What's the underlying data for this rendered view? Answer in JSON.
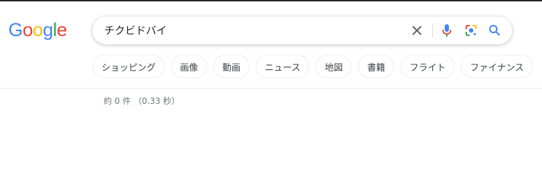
{
  "logo": {
    "text": "Google",
    "letters": [
      {
        "ch": "G",
        "color": "#4285F4"
      },
      {
        "ch": "o",
        "color": "#EA4335"
      },
      {
        "ch": "o",
        "color": "#FBBC05"
      },
      {
        "ch": "g",
        "color": "#4285F4"
      },
      {
        "ch": "l",
        "color": "#34A853"
      },
      {
        "ch": "e",
        "color": "#EA4335"
      }
    ]
  },
  "search": {
    "query": "チクビドバイ",
    "icons": [
      "clear-icon",
      "microphone-icon",
      "lens-camera-icon",
      "search-icon"
    ]
  },
  "chips": [
    "ショッピング",
    "画像",
    "動画",
    "ニュース",
    "地図",
    "書籍",
    "フライト",
    "ファイナンス"
  ],
  "results": {
    "stats": "約 0 件 （0.33 秒）"
  },
  "colors": {
    "blue": "#4285F4",
    "red": "#EA4335",
    "yellow": "#FBBC05",
    "green": "#34A853",
    "icon_gray": "#70757a",
    "search_blue": "#4285F4"
  }
}
